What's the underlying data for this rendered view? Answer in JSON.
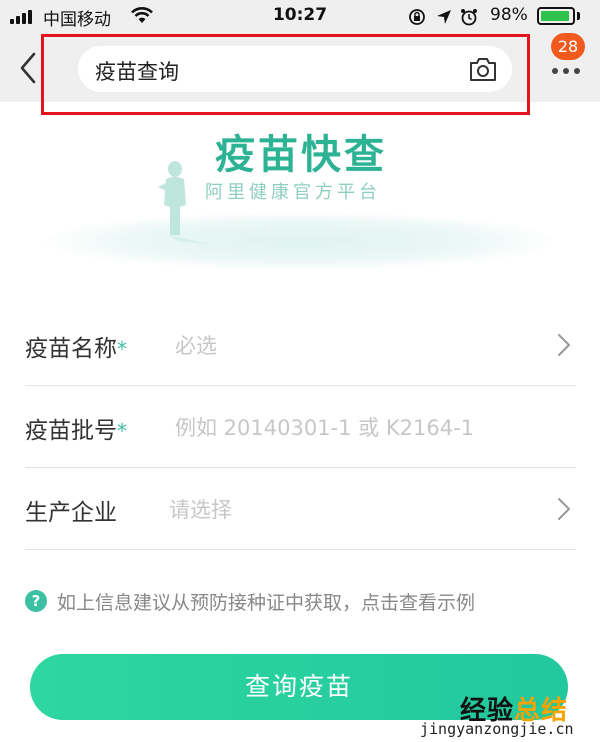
{
  "status_bar": {
    "carrier": "中国移动",
    "time": "10:27",
    "battery_percent": "98%",
    "battery_level": 0.98,
    "icons": [
      "orientation-lock-icon",
      "location-icon",
      "alarm-icon"
    ]
  },
  "nav": {
    "search_value": "疫苗查询",
    "notification_count": "28",
    "accent_color": "#e3141b"
  },
  "hero": {
    "title": "疫苗快查",
    "subtitle": "阿里健康官方平台"
  },
  "form": {
    "rows": [
      {
        "label": "疫苗名称",
        "required_mark": "*",
        "placeholder": "必选"
      },
      {
        "label": "疫苗批号",
        "required_mark": "*",
        "placeholder": "例如 20140301-1 或 K2164-1"
      },
      {
        "label": "生产企业",
        "required_mark": "",
        "placeholder": "请选择"
      }
    ]
  },
  "hint": {
    "icon_text": "?",
    "text": "如上信息建议从预防接种证中获取，点击查看示例"
  },
  "submit": {
    "label": "查询疫苗",
    "color": "#2ed6a0"
  },
  "watermark": {
    "main_a": "经验",
    "main_b": "总结",
    "url": "jingyanzongjie.cn"
  }
}
